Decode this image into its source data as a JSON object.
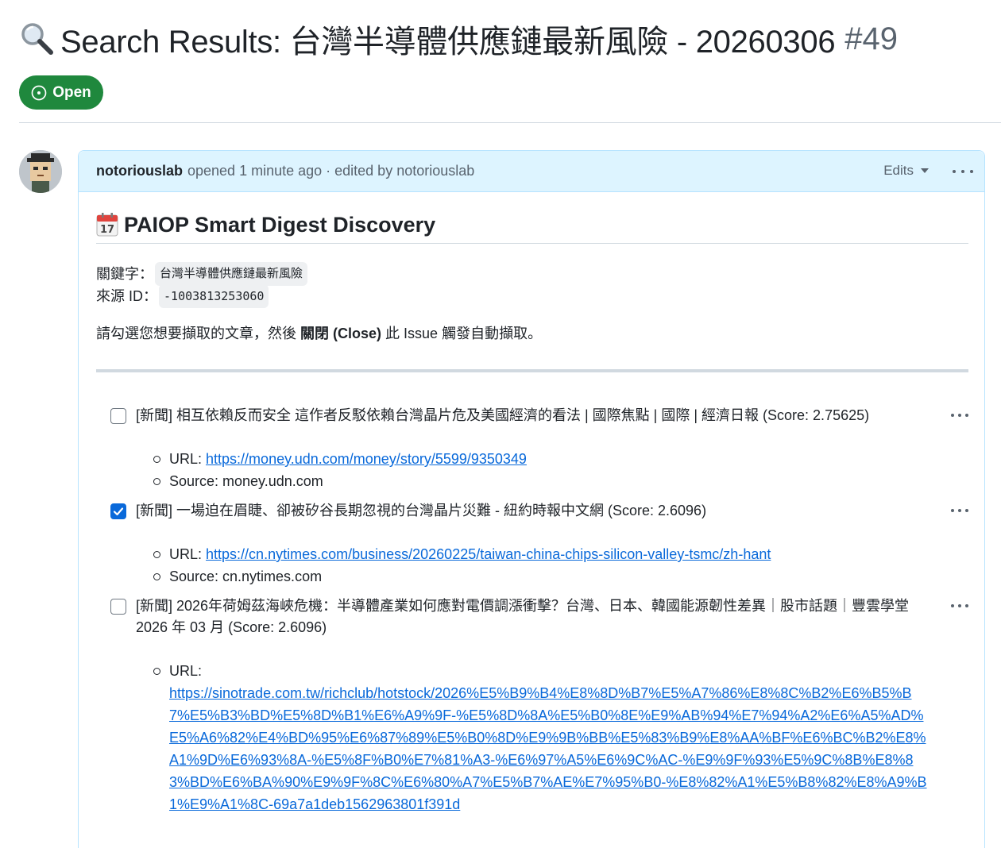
{
  "issue": {
    "title": "Search Results: 台灣半導體供應鏈最新風險 - 20260306",
    "number": "#49",
    "state": "Open"
  },
  "comment": {
    "author": "notoriouslab",
    "meta": "opened 1 minute ago · edited by notoriouslab",
    "edits_label": "Edits",
    "heading": "PAIOP Smart Digest Discovery",
    "keyword_label": "關鍵字：",
    "keyword_value": "台灣半導體供應鏈最新風險",
    "source_id_label": "來源 ID：",
    "source_id_value": "-1003813253060",
    "instruction_pre": "請勾選您想要擷取的文章，然後",
    "instruction_bold": "關閉 (Close)",
    "instruction_post": "此 Issue 觸發自動擷取。"
  },
  "tasks": [
    {
      "checked": false,
      "title": "[新聞] 相互依賴反而安全 這作者反駁依賴台灣晶片危及美國經濟的看法 | 國際焦點 | 國際 | 經濟日報 (Score: 2.75625)",
      "url_label": "URL:",
      "url": "https://money.udn.com/money/story/5599/9350349",
      "source": "Source: money.udn.com"
    },
    {
      "checked": true,
      "title": "[新聞] 一場迫在眉睫、卻被矽谷長期忽視的台灣晶片災難 - 紐約時報中文網 (Score: 2.6096)",
      "url_label": "URL:",
      "url": "https://cn.nytimes.com/business/20260225/taiwan-china-chips-silicon-valley-tsmc/zh-hant",
      "source": "Source: cn.nytimes.com"
    },
    {
      "checked": false,
      "title": "[新聞] 2026年荷姆茲海峽危機：半導體產業如何應對電價調漲衝擊？台灣、日本、韓國能源韌性差異｜股市話題｜豐雲學堂 2026 年 03 月 (Score: 2.6096)",
      "url_label": "URL:",
      "url": "https://sinotrade.com.tw/richclub/hotstock/2026%E5%B9%B4%E8%8D%B7%E5%A7%86%E8%8C%B2%E6%B5%B7%E5%B3%BD%E5%8D%B1%E6%A9%9F-%E5%8D%8A%E5%B0%8E%E9%AB%94%E7%94%A2%E6%A5%AD%E5%A6%82%E4%BD%95%E6%87%89%E5%B0%8D%E9%9B%BB%E5%83%B9%E8%AA%BF%E6%BC%B2%E8%A1%9D%E6%93%8A-%E5%8F%B0%E7%81%A3-%E6%97%A5%E6%9C%AC-%E9%9F%93%E5%9C%8B%E8%83%BD%E6%BA%90%E9%9F%8C%E6%80%A7%E5%B7%AE%E7%95%B0-%E8%82%A1%E5%B8%82%E8%A9%B1%E9%A1%8C-69a7a1deb1562963801f391d"
    }
  ],
  "colors": {
    "open_green": "#1f883d",
    "link_blue": "#0969da",
    "header_bg": "#ddf4ff",
    "header_border": "#b6e3ff"
  },
  "icons": {
    "title": "magnifier-icon",
    "state": "issue-opened-icon",
    "heading": "calendar-icon"
  }
}
